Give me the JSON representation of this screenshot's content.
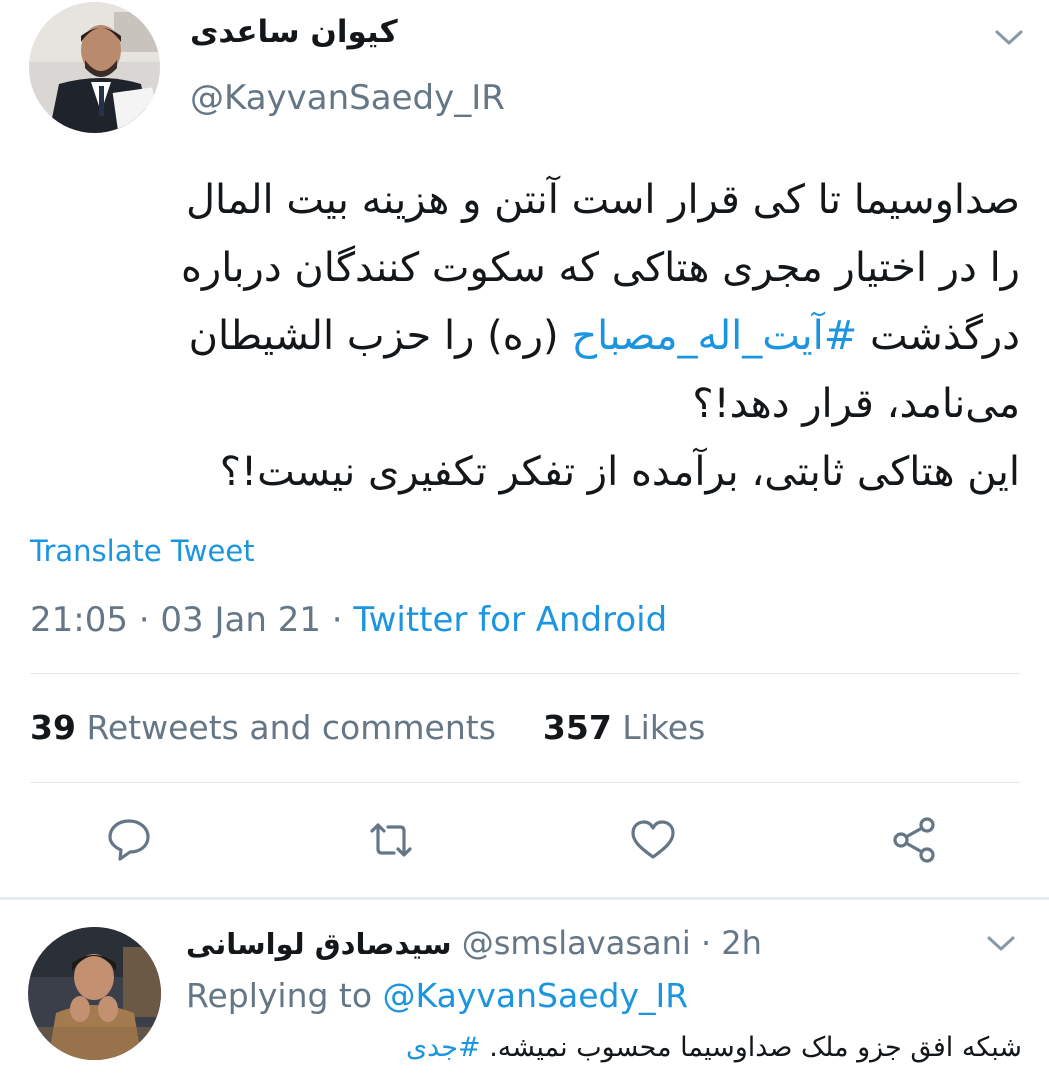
{
  "main_tweet": {
    "author_name": "کیوان ساعدی",
    "author_handle": "@KayvanSaedy_IR",
    "text_lines": [
      {
        "parts": [
          {
            "text": "صداوسیما تا کی قرار است آنتن و هزینه بیت المال",
            "hashtag": false
          }
        ]
      },
      {
        "parts": [
          {
            "text": "را در اختیار مجری هتاکی که سکوت کنندگان درباره",
            "hashtag": false
          }
        ]
      },
      {
        "parts": [
          {
            "text": "درگذشت ",
            "hashtag": false
          },
          {
            "text": "#آیت_اله_مصباح",
            "hashtag": true
          },
          {
            "text": " (ره) را حزب الشیطان",
            "hashtag": false
          }
        ]
      },
      {
        "parts": [
          {
            "text": "می‌نامد، قرار دهد!؟",
            "hashtag": false
          }
        ]
      },
      {
        "parts": [
          {
            "text": "این هتاکی ثابتی، برآمده از تفکر تکفیری نیست!؟",
            "hashtag": false
          }
        ]
      }
    ],
    "translate_label": "Translate Tweet",
    "time": "21:05",
    "date": "03 Jan 21",
    "source": "Twitter for Android",
    "retweets_count": "39",
    "retweets_label": "Retweets and comments",
    "likes_count": "357",
    "likes_label": "Likes"
  },
  "actions": {
    "reply_icon": "reply-icon",
    "retweet_icon": "retweet-icon",
    "like_icon": "heart-icon",
    "share_icon": "share-icon"
  },
  "reply_tweet": {
    "author_name": "سیدصادق لواسانی",
    "author_handle": "@smslavasani",
    "time_ago": "2h",
    "replying_prefix": "Replying to",
    "replying_to": "@KayvanSaedy_IR",
    "text": "شبکه افق جزو ملک صداوسیما محسوب نمیشه.",
    "hashtag": "#جدی"
  },
  "colors": {
    "link": "#1b95e0",
    "secondary_text": "#657786",
    "primary_text": "#14171a",
    "divider": "#e1e8ed"
  }
}
